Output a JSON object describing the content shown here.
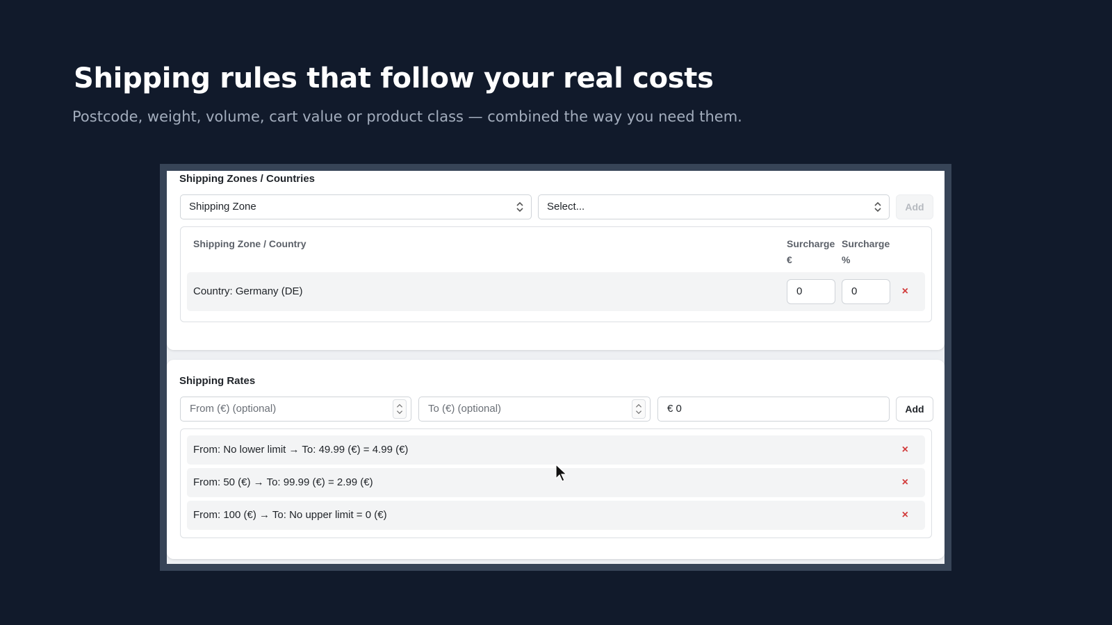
{
  "hero": {
    "title": "Shipping rules that follow your real costs",
    "subtitle": "Postcode, weight, volume, cart value or product class — combined the way you need them."
  },
  "zones": {
    "section_title": "Shipping Zones / Countries",
    "type_select": "Shipping Zone",
    "value_select": "Select...",
    "add_label": "Add",
    "col_zone": "Shipping Zone / Country",
    "col_surcharge_eur_line1": "Surcharge",
    "col_surcharge_eur_line2": "€",
    "col_surcharge_pct_line1": "Surcharge",
    "col_surcharge_pct_line2": "%",
    "rows": [
      {
        "label": "Country: Germany (DE)",
        "surcharge_eur": "0",
        "surcharge_pct": "0",
        "delete": "×"
      }
    ]
  },
  "rates": {
    "section_title": "Shipping Rates",
    "from_placeholder": "From (€) (optional)",
    "to_placeholder": "To (€) (optional)",
    "price_value": "€ 0",
    "add_label": "Add",
    "rows": [
      {
        "label": "From: No lower limit → To: 49.99 (€) = 4.99 (€)",
        "delete": "×"
      },
      {
        "label": "From: 50 (€) → To: 99.99 (€) = 2.99 (€)",
        "delete": "×"
      },
      {
        "label": "From: 100 (€) → To: No upper limit = 0 (€)",
        "delete": "×"
      }
    ]
  },
  "icons": {
    "chevron": "chevron-updown-icon",
    "delete": "close-icon",
    "cursor": "mouse-pointer-icon"
  },
  "colors": {
    "background": "#111a2b",
    "delete_red": "#d23b3b"
  }
}
